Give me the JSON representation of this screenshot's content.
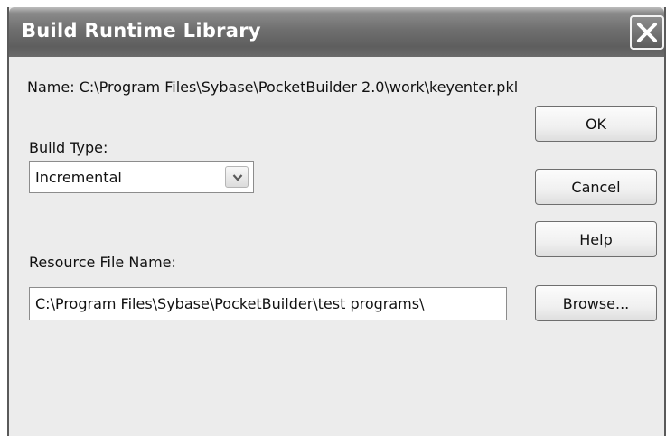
{
  "window": {
    "title": "Build Runtime Library",
    "close_icon": "close-icon"
  },
  "form": {
    "name_label": "Name: C:\\Program Files\\Sybase\\PocketBuilder 2.0\\work\\keyenter.pkl",
    "build_type_label": "Build Type:",
    "build_type_value": "Incremental",
    "resource_file_label": "Resource File Name:",
    "resource_file_value": "C:\\Program Files\\Sybase\\PocketBuilder\\test programs\\"
  },
  "buttons": {
    "ok": "OK",
    "cancel": "Cancel",
    "help": "Help",
    "browse": "Browse..."
  },
  "colors": {
    "titlebar": "#6f6f6f",
    "dialog_background": "#ececec",
    "title_text": "#ffffff"
  }
}
